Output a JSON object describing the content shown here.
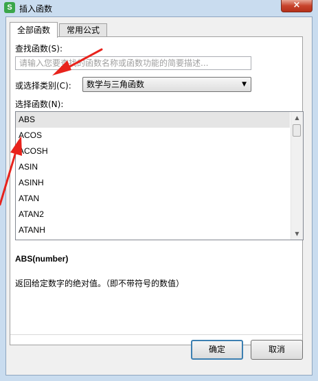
{
  "window": {
    "app_icon": "S",
    "title": "插入函数",
    "close_symbol": "×"
  },
  "tabs": [
    {
      "label": "全部函数",
      "active": true
    },
    {
      "label": "常用公式",
      "active": false
    }
  ],
  "search": {
    "label": "查找函数(S):",
    "placeholder": "请输入您要查找的函数名称或函数功能的简要描述..."
  },
  "category": {
    "label": "或选择类别(C):",
    "selected": "数学与三角函数"
  },
  "function_list": {
    "label": "选择函数(N):",
    "items": [
      "ABS",
      "ACOS",
      "ACOSH",
      "ASIN",
      "ASINH",
      "ATAN",
      "ATAN2",
      "ATANH"
    ],
    "selected_index": 0
  },
  "function_info": {
    "signature": "ABS(number)",
    "description": "返回给定数字的绝对值。（即不带符号的数值）"
  },
  "buttons": {
    "ok": "确定",
    "cancel": "取消"
  },
  "colors": {
    "annotation_arrow": "#e8231c",
    "titlebar": "#c9dcef",
    "close_button": "#c7432c"
  }
}
